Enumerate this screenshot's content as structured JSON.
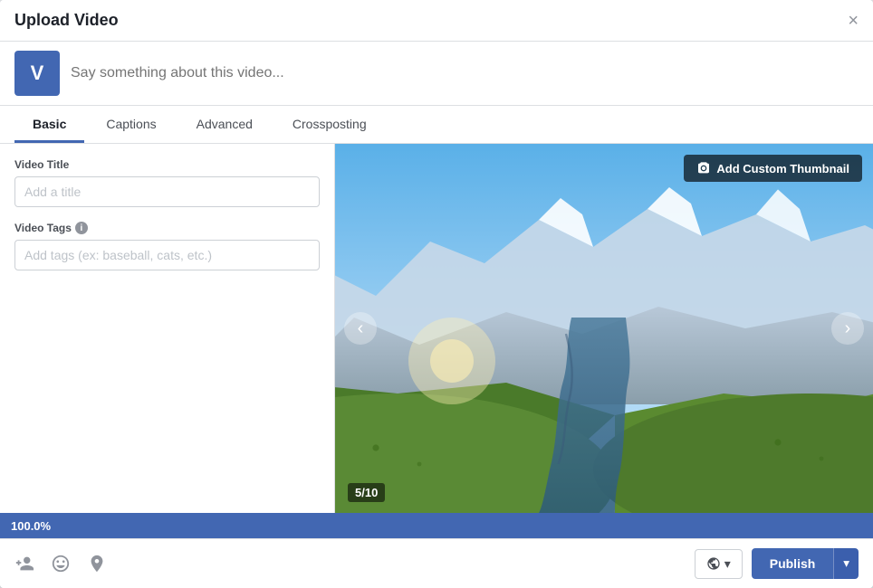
{
  "modal": {
    "title": "Upload Video",
    "close_label": "×"
  },
  "status": {
    "avatar_letter": "V",
    "input_placeholder": "Say something about this video..."
  },
  "tabs": [
    {
      "id": "basic",
      "label": "Basic",
      "active": true
    },
    {
      "id": "captions",
      "label": "Captions",
      "active": false
    },
    {
      "id": "advanced",
      "label": "Advanced",
      "active": false
    },
    {
      "id": "crossposting",
      "label": "Crossposting",
      "active": false
    }
  ],
  "form": {
    "video_title_label": "Video Title",
    "video_title_placeholder": "Add a title",
    "video_tags_label": "Video Tags",
    "video_tags_info": "i",
    "video_tags_placeholder": "Add tags (ex: baseball, cats, etc.)"
  },
  "video": {
    "thumbnail_btn": "Add Custom Thumbnail",
    "slide_counter": "5/10",
    "nav_left": "‹",
    "nav_right": "›"
  },
  "progress": {
    "value": "100.0%"
  },
  "footer": {
    "audience_label": "🌐",
    "audience_dropdown": "▾",
    "publish_label": "Publish",
    "publish_dropdown": "▾",
    "icons": [
      {
        "name": "tag-people-icon",
        "symbol": "👤+",
        "unicode": ""
      },
      {
        "name": "emoji-icon",
        "symbol": "😊",
        "unicode": ""
      },
      {
        "name": "location-icon",
        "symbol": "📍",
        "unicode": ""
      }
    ]
  },
  "colors": {
    "brand_blue": "#4267b2",
    "progress_bar": "#4267b2"
  }
}
